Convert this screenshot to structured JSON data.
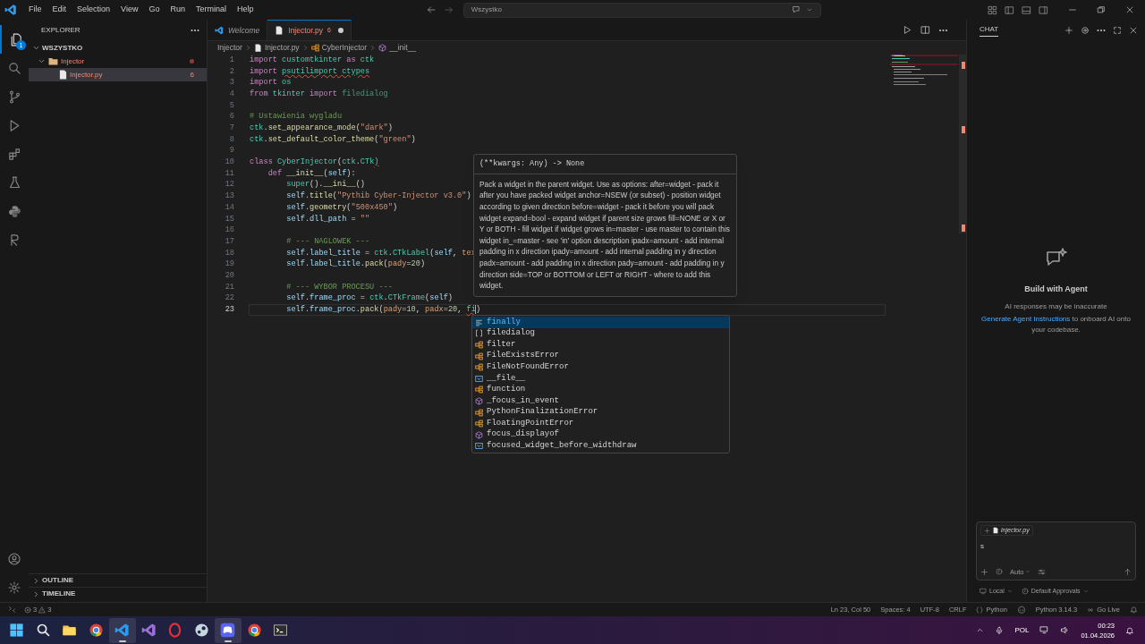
{
  "title_bar": {
    "menu": [
      "File",
      "Edit",
      "Selection",
      "View",
      "Go",
      "Run",
      "Terminal",
      "Help"
    ],
    "search": {
      "value": "Wszystko"
    }
  },
  "activity_bar": {
    "items": [
      {
        "kind": "explorer",
        "selected": true,
        "badge": "1"
      },
      {
        "kind": "search",
        "selected": false
      },
      {
        "kind": "source-control",
        "selected": false
      },
      {
        "kind": "run",
        "selected": false
      },
      {
        "kind": "extensions",
        "selected": false
      },
      {
        "kind": "testing",
        "selected": false
      },
      {
        "kind": "python",
        "selected": false
      },
      {
        "kind": "remote",
        "selected": false
      }
    ],
    "bottom": [
      {
        "kind": "account"
      },
      {
        "kind": "settings"
      }
    ]
  },
  "explorer": {
    "title": "EXPLORER",
    "root": "WSZYSTKO",
    "tree": [
      {
        "label": "Injector",
        "kind": "folder",
        "expanded": true,
        "selected": false,
        "problem_dot": true,
        "children": [
          {
            "label": "Injector.py",
            "kind": "file",
            "selected": true,
            "badge": "6"
          }
        ]
      }
    ],
    "sections": [
      {
        "label": "OUTLINE",
        "expanded": false
      },
      {
        "label": "TIMELINE",
        "expanded": false
      }
    ]
  },
  "tabs": [
    {
      "label": "Welcome",
      "kind": "welcome",
      "selected": false,
      "preview": true,
      "modified": false
    },
    {
      "label": "Injector.py",
      "kind": "python",
      "selected": true,
      "preview": false,
      "modified": true,
      "badge": "6"
    }
  ],
  "breadcrumbs": [
    {
      "label": "Injector",
      "kind": "folder"
    },
    {
      "label": "Injector.py",
      "kind": "file"
    },
    {
      "label": "CyberInjector",
      "kind": "class"
    },
    {
      "label": "__init__",
      "kind": "method"
    }
  ],
  "editor": {
    "lines": [
      {
        "number": "1",
        "current": false,
        "tokens": [
          {
            "text": "import",
            "kind": "kw"
          },
          {
            "text": " customtkinter",
            "kind": "mod"
          },
          {
            "text": " as",
            "kind": "kw"
          },
          {
            "text": " ctk",
            "kind": "mod"
          }
        ]
      },
      {
        "number": "2",
        "current": false,
        "tokens": [
          {
            "text": "import ",
            "kind": "kw"
          },
          {
            "text": "psutilimport",
            "kind": "err"
          },
          {
            "text": " ctypes",
            "kind": "err"
          }
        ]
      },
      {
        "number": "3",
        "current": false,
        "tokens": [
          {
            "text": "import",
            "kind": "kw"
          },
          {
            "text": " os",
            "kind": "mod"
          }
        ]
      },
      {
        "number": "4",
        "current": false,
        "tokens": [
          {
            "text": "from",
            "kind": "kw"
          },
          {
            "text": " tkinter",
            "kind": "mod"
          },
          {
            "text": " import",
            "kind": "kw"
          },
          {
            "text": " filedialog",
            "kind": "dim"
          }
        ]
      },
      {
        "number": "5",
        "current": false
      },
      {
        "number": "6",
        "current": false,
        "tokens": [
          {
            "text": "# Ustawienia wygladu",
            "kind": "cm"
          }
        ]
      },
      {
        "number": "7",
        "current": false,
        "tokens": [
          {
            "text": "ctk",
            "kind": "mod"
          },
          {
            "text": ".",
            "kind": "txt"
          },
          {
            "text": "set_appearance_mode",
            "kind": "fn"
          },
          {
            "text": "(",
            "kind": "txt"
          },
          {
            "text": "\"dark\"",
            "kind": "str"
          },
          {
            "text": ")",
            "kind": "txt"
          }
        ]
      },
      {
        "number": "8",
        "current": false,
        "tokens": [
          {
            "text": "ctk",
            "kind": "mod"
          },
          {
            "text": ".",
            "kind": "txt"
          },
          {
            "text": "set_default_color_theme",
            "kind": "fn"
          },
          {
            "text": "(",
            "kind": "txt"
          },
          {
            "text": "\"green\"",
            "kind": "str"
          },
          {
            "text": ")",
            "kind": "txt"
          }
        ]
      },
      {
        "number": "9",
        "current": false
      },
      {
        "number": "10",
        "current": false,
        "tokens": [
          {
            "text": "class ",
            "kind": "kw"
          },
          {
            "text": "CyberInjector",
            "kind": "mod"
          },
          {
            "text": "(",
            "kind": "txt"
          },
          {
            "text": "ctk",
            "kind": "mod"
          },
          {
            "text": ".",
            "kind": "txt"
          },
          {
            "text": "CTk",
            "kind": "mod"
          },
          {
            "text": ")",
            "kind": "err"
          }
        ]
      },
      {
        "number": "11",
        "current": false,
        "tokens": [
          {
            "text": "    def ",
            "kind": "kw"
          },
          {
            "text": "__init__",
            "kind": "fn"
          },
          {
            "text": "(",
            "kind": "txt"
          },
          {
            "text": "self",
            "kind": "par"
          },
          {
            "text": "):",
            "kind": "txt"
          }
        ]
      },
      {
        "number": "12",
        "current": false,
        "tokens": [
          {
            "text": "        super",
            "kind": "mod"
          },
          {
            "text": "().",
            "kind": "txt"
          },
          {
            "text": "__ini__",
            "kind": "fn"
          },
          {
            "text": "()",
            "kind": "txt"
          }
        ]
      },
      {
        "number": "13",
        "current": false,
        "tokens": [
          {
            "text": "        self",
            "kind": "par"
          },
          {
            "text": ".",
            "kind": "txt"
          },
          {
            "text": "title",
            "kind": "fn"
          },
          {
            "text": "(",
            "kind": "txt"
          },
          {
            "text": "\"Pythib Cyber-Injector v3.0\"",
            "kind": "str"
          },
          {
            "text": ")",
            "kind": "txt"
          }
        ]
      },
      {
        "number": "14",
        "current": false,
        "tokens": [
          {
            "text": "        self",
            "kind": "par"
          },
          {
            "text": ".",
            "kind": "txt"
          },
          {
            "text": "geometry",
            "kind": "fn"
          },
          {
            "text": "(",
            "kind": "txt"
          },
          {
            "text": "\"500x450\"",
            "kind": "str"
          },
          {
            "text": ")",
            "kind": "txt"
          }
        ]
      },
      {
        "number": "15",
        "current": false,
        "tokens": [
          {
            "text": "        self",
            "kind": "par"
          },
          {
            "text": ".",
            "kind": "txt"
          },
          {
            "text": "dll_path",
            "kind": "par"
          },
          {
            "text": " = ",
            "kind": "txt"
          },
          {
            "text": "\"\"",
            "kind": "str"
          }
        ]
      },
      {
        "number": "16",
        "current": false
      },
      {
        "number": "17",
        "current": false,
        "tokens": [
          {
            "text": "        # --- NAGLOWEK ---",
            "kind": "cm"
          }
        ]
      },
      {
        "number": "18",
        "current": false,
        "tokens": [
          {
            "text": "        self",
            "kind": "par"
          },
          {
            "text": ".",
            "kind": "txt"
          },
          {
            "text": "label_title",
            "kind": "par"
          },
          {
            "text": " = ",
            "kind": "txt"
          },
          {
            "text": "ctk",
            "kind": "mod"
          },
          {
            "text": ".",
            "kind": "txt"
          },
          {
            "text": "CTkLabel",
            "kind": "mod"
          },
          {
            "text": "(",
            "kind": "txt"
          },
          {
            "text": "self",
            "kind": "par"
          },
          {
            "text": ", ",
            "kind": "txt"
          },
          {
            "text": "tex",
            "kind": "arg"
          }
        ]
      },
      {
        "number": "19",
        "current": false,
        "tokens": [
          {
            "text": "        self",
            "kind": "par"
          },
          {
            "text": ".",
            "kind": "txt"
          },
          {
            "text": "label_title",
            "kind": "par"
          },
          {
            "text": ".",
            "kind": "txt"
          },
          {
            "text": "pack",
            "kind": "fn"
          },
          {
            "text": "(",
            "kind": "txt"
          },
          {
            "text": "pady",
            "kind": "arg"
          },
          {
            "text": "=",
            "kind": "txt"
          },
          {
            "text": "20",
            "kind": "num"
          },
          {
            "text": ")",
            "kind": "txt"
          }
        ]
      },
      {
        "number": "20",
        "current": false
      },
      {
        "number": "21",
        "current": false,
        "tokens": [
          {
            "text": "        # --- WYBOR PROCESU ---",
            "kind": "cm"
          }
        ]
      },
      {
        "number": "22",
        "current": false,
        "tokens": [
          {
            "text": "        self",
            "kind": "par"
          },
          {
            "text": ".",
            "kind": "txt"
          },
          {
            "text": "frame_proc",
            "kind": "par"
          },
          {
            "text": " = ",
            "kind": "txt"
          },
          {
            "text": "ctk",
            "kind": "mod"
          },
          {
            "text": ".",
            "kind": "txt"
          },
          {
            "text": "CTkFrame",
            "kind": "mod"
          },
          {
            "text": "(",
            "kind": "txt"
          },
          {
            "text": "self",
            "kind": "par"
          },
          {
            "text": ")",
            "kind": "txt"
          }
        ]
      },
      {
        "number": "23",
        "current": true,
        "tokens": [
          {
            "text": "        self",
            "kind": "par"
          },
          {
            "text": ".",
            "kind": "txt"
          },
          {
            "text": "frame_proc",
            "kind": "par"
          },
          {
            "text": ".",
            "kind": "txt"
          },
          {
            "text": "pack",
            "kind": "fn"
          },
          {
            "text": "(",
            "kind": "txt"
          },
          {
            "text": "pady",
            "kind": "arg"
          },
          {
            "text": "=",
            "kind": "txt"
          },
          {
            "text": "10",
            "kind": "num"
          },
          {
            "text": ", ",
            "kind": "txt"
          },
          {
            "text": "padx",
            "kind": "arg"
          },
          {
            "text": "=",
            "kind": "txt"
          },
          {
            "text": "20",
            "kind": "num"
          },
          {
            "text": ", ",
            "kind": "txt"
          },
          {
            "text": "fi",
            "kind": "err"
          },
          {
            "text": ")",
            "kind": "txt"
          }
        ]
      }
    ],
    "hover": {
      "signature": "(**kwargs: Any) -> None",
      "doc": "Pack a widget in the parent widget. Use as options: after=widget - pack it after you have packed widget anchor=NSEW (or subset) - position widget according to given direction before=widget - pack it before you will pack widget expand=bool - expand widget if parent size grows fill=NONE or X or Y or BOTH - fill widget if widget grows in=master - use master to contain this widget in_=master - see 'in' option description ipadx=amount - add internal padding in x direction ipady=amount - add internal padding in y direction padx=amount - add padding in x direction pady=amount - add padding in y direction side=TOP or BOTTOM or LEFT or RIGHT - where to add this widget."
    },
    "completions": [
      {
        "label": "finally",
        "kind": "keyword",
        "selected": true
      },
      {
        "label": "filedialog",
        "kind": "module",
        "selected": false
      },
      {
        "label": "filter",
        "kind": "class",
        "selected": false
      },
      {
        "label": "FileExistsError",
        "kind": "class",
        "selected": false
      },
      {
        "label": "FileNotFoundError",
        "kind": "class",
        "selected": false
      },
      {
        "label": "__file__",
        "kind": "variable",
        "selected": false
      },
      {
        "label": "function",
        "kind": "class",
        "selected": false
      },
      {
        "label": "_focus_in_event",
        "kind": "method",
        "selected": false
      },
      {
        "label": "PythonFinalizationError",
        "kind": "class",
        "selected": false
      },
      {
        "label": "FloatingPointError",
        "kind": "class",
        "selected": false
      },
      {
        "label": "focus_displayof",
        "kind": "method",
        "selected": false
      },
      {
        "label": "focused_widget_before_widthdraw",
        "kind": "variable",
        "selected": false
      }
    ]
  },
  "chat": {
    "title": "CHAT",
    "empty_title": "Build with Agent",
    "notice": "AI responses may be inaccurate",
    "link": "Generate Agent Instructions",
    "link_rest": "to onboard AI onto your codebase.",
    "input": {
      "attachment": "injector.py",
      "value": "s",
      "mode": "Auto"
    },
    "footer": [
      "Local",
      "Default Approvals"
    ]
  },
  "status_bar": {
    "errors": "3",
    "warnings": "3",
    "items": [
      {
        "kind": "text",
        "label": "Ln 23, Col 50"
      },
      {
        "kind": "text",
        "label": "Spaces: 4"
      },
      {
        "kind": "text",
        "label": "UTF-8"
      },
      {
        "kind": "text",
        "label": "CRLF"
      },
      {
        "kind": "language",
        "label": "Python"
      },
      {
        "kind": "copilot"
      },
      {
        "kind": "text",
        "label": "Python 3.14.3"
      },
      {
        "kind": "live",
        "label": "Go Live"
      },
      {
        "kind": "bell"
      }
    ]
  },
  "taskbar": {
    "apps": [
      {
        "kind": "start",
        "selected": false
      },
      {
        "kind": "search",
        "selected": false
      },
      {
        "kind": "files",
        "selected": false
      },
      {
        "kind": "browser",
        "selected": false
      },
      {
        "kind": "code",
        "selected": true
      },
      {
        "kind": "ide",
        "selected": false
      },
      {
        "kind": "ring",
        "selected": false
      },
      {
        "kind": "steam",
        "selected": false
      },
      {
        "kind": "chat",
        "selected": true
      },
      {
        "kind": "browser",
        "selected": false
      },
      {
        "kind": "terminal",
        "selected": false
      }
    ],
    "tray": {
      "language": "POL",
      "time": "00:23",
      "date": "01.04.2026"
    }
  }
}
